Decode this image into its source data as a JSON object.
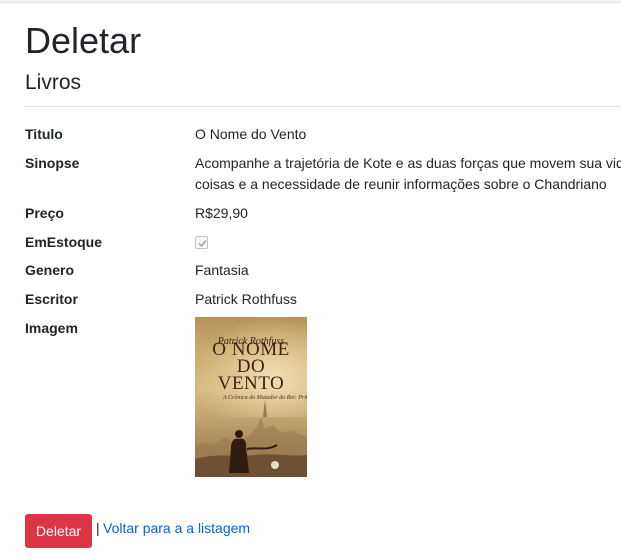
{
  "page": {
    "title": "Deletar",
    "subtitle": "Livros"
  },
  "details": {
    "titulo": {
      "label": "Titulo",
      "value": "O Nome do Vento"
    },
    "sinopse": {
      "label": "Sinopse",
      "line1": "Acompanhe a trajetória de Kote e as duas forças que movem sua vida",
      "line2": "coisas e a necessidade de reunir informações sobre o Chandriano"
    },
    "preco": {
      "label": "Preço",
      "value": "R$29,90"
    },
    "emEstoque": {
      "label": "EmEstoque",
      "checked": true
    },
    "genero": {
      "label": "Genero",
      "value": "Fantasia"
    },
    "escritor": {
      "label": "Escritor",
      "value": "Patrick Rothfuss"
    },
    "imagem": {
      "label": "Imagem",
      "cover_author": "Patrick Rothfuss",
      "cover_title_1": "O NOME",
      "cover_title_2": "DO",
      "cover_title_3": "VENTO",
      "cover_subtitle": "A Crônica do Matador do Rei: Primeiro Dia"
    }
  },
  "actions": {
    "delete_label": "Deletar",
    "separator": "|",
    "back_label": "Voltar para a a listagem"
  },
  "colors": {
    "danger": "#dc3545",
    "link": "#0366d6"
  }
}
